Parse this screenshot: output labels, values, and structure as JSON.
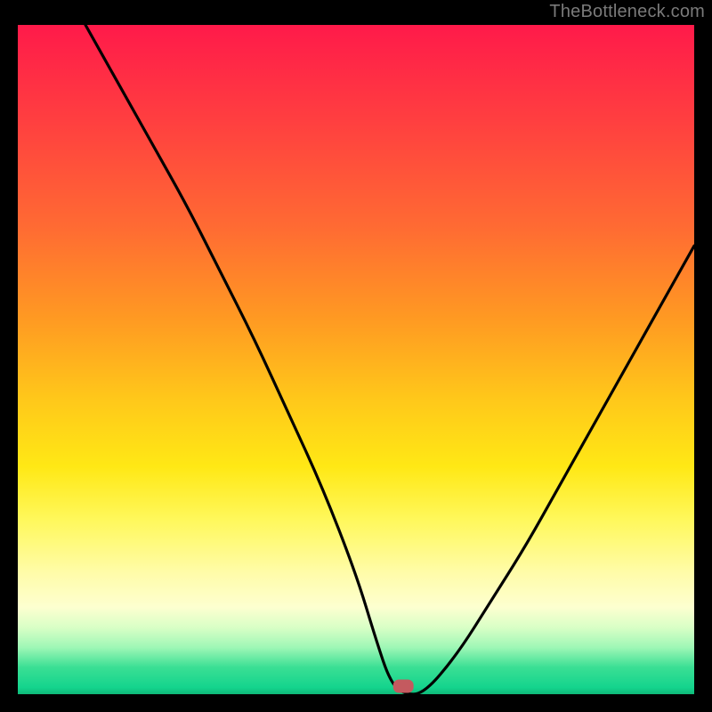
{
  "watermark": "TheBottleneck.com",
  "chart_data": {
    "type": "line",
    "title": "",
    "xlabel": "",
    "ylabel": "",
    "xlim": [
      0,
      100
    ],
    "ylim": [
      0,
      100
    ],
    "grid": false,
    "legend": null,
    "series": [
      {
        "name": "curve",
        "x": [
          10,
          15,
          20,
          25,
          30,
          35,
          40,
          45,
          50,
          53,
          55,
          57,
          60,
          65,
          70,
          75,
          80,
          85,
          90,
          95,
          100
        ],
        "values": [
          100,
          91,
          82,
          73,
          63,
          53,
          42,
          31,
          18,
          8,
          2,
          0,
          0,
          6,
          14,
          22,
          31,
          40,
          49,
          58,
          67
        ]
      }
    ],
    "marker": {
      "x": 57,
      "y": 0,
      "shape": "rounded-rect",
      "color": "#c45a5f"
    },
    "background_gradient": {
      "orientation": "vertical",
      "stops": [
        {
          "pos": 0.0,
          "color": "#ff1a4a"
        },
        {
          "pos": 0.3,
          "color": "#ff6a33"
        },
        {
          "pos": 0.55,
          "color": "#ffc81a"
        },
        {
          "pos": 0.75,
          "color": "#fff85c"
        },
        {
          "pos": 0.88,
          "color": "#fdffd0"
        },
        {
          "pos": 0.96,
          "color": "#3adf94"
        },
        {
          "pos": 1.0,
          "color": "#0fb978"
        }
      ]
    }
  }
}
